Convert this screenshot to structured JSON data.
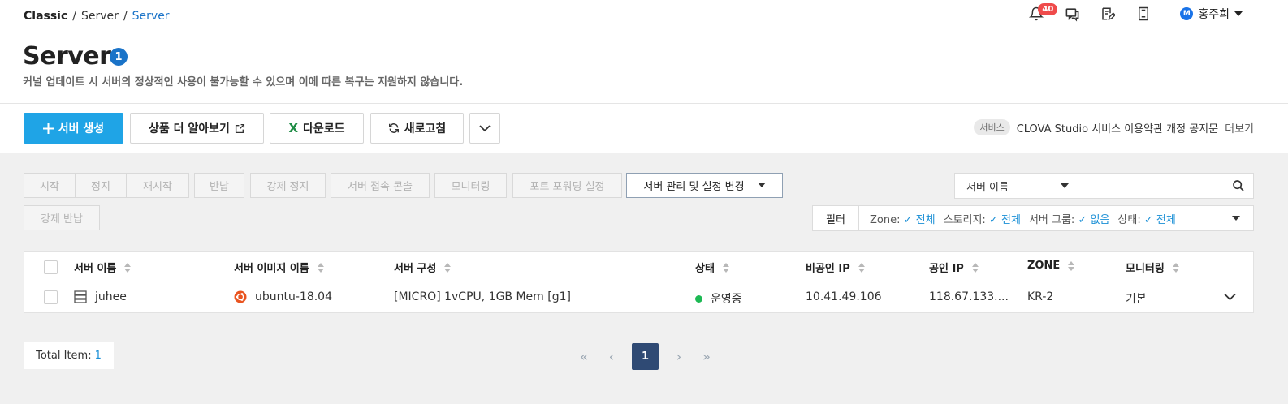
{
  "breadcrumb": {
    "root": "Classic",
    "level1": "Server",
    "current": "Server"
  },
  "header": {
    "notification_count": "40",
    "user_initial": "M",
    "user_name": "홍주희"
  },
  "page": {
    "title": "Server",
    "title_count": "1",
    "subtitle": "커널 업데이트 시 서버의 정상적인 사용이 불가능할 수 있으며 이에 따른 복구는 지원하지 않습니다."
  },
  "toolbar": {
    "create": "서버 생성",
    "learn_more": "상품 더 알아보기",
    "download": "다운로드",
    "refresh": "새로고침"
  },
  "notice": {
    "tag": "서비스",
    "text": "CLOVA Studio 서비스 이용약관 개정 공지문",
    "more": "더보기"
  },
  "actions": {
    "start": "시작",
    "stop": "정지",
    "restart": "재시작",
    "return": "반납",
    "force_stop": "강제 정지",
    "console": "서버 접속 콘솔",
    "monitoring": "모니터링",
    "port_forwarding": "포트 포워딩 설정",
    "manage": "서버 관리 및 설정 변경",
    "force_return": "강제 반납"
  },
  "search": {
    "field": "서버 이름",
    "placeholder": ""
  },
  "filter": {
    "label": "필터",
    "zone_label": "Zone:",
    "zone_value": "전체",
    "storage_label": "스토리지:",
    "storage_value": "전체",
    "group_label": "서버 그룹:",
    "group_value": "없음",
    "status_label": "상태:",
    "status_value": "전체"
  },
  "table": {
    "columns": [
      "서버 이름",
      "서버 이미지 이름",
      "서버 구성",
      "상태",
      "비공인 IP",
      "공인 IP",
      "ZONE",
      "모니터링"
    ],
    "rows": [
      {
        "name": "juhee",
        "image": "ubuntu-18.04",
        "spec": "[MICRO] 1vCPU, 1GB Mem [g1]",
        "status": "운영중",
        "private_ip": "10.41.49.106",
        "public_ip": "118.67.133....",
        "zone": "KR-2",
        "monitoring": "기본"
      }
    ]
  },
  "footer": {
    "total_label": "Total Item:",
    "total_value": "1",
    "current_page": "1"
  },
  "colors": {
    "primary": "#1fa4e6",
    "link": "#1a73c8",
    "badge": "#ef4b4b",
    "status_ok": "#1db954",
    "pager_active": "#2f4a74"
  }
}
